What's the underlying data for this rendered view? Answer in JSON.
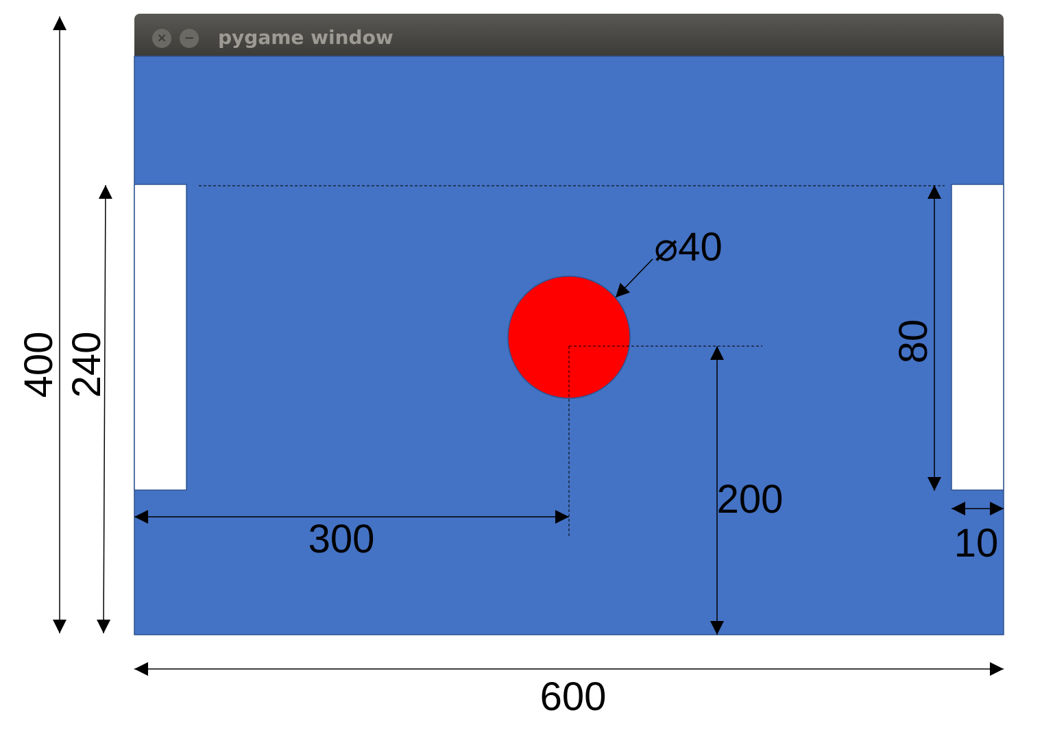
{
  "window": {
    "title": "pygame window"
  },
  "colors": {
    "background": "#4472c4",
    "ball": "#ff0000",
    "paddle": "#ffffff",
    "titlebar": "#3c3b37"
  },
  "icons": {
    "close": "close-icon",
    "minimize": "minimize-icon"
  },
  "dimensions": {
    "window_width": "600",
    "window_height": "400",
    "play_height": "240",
    "paddle_height": "80",
    "paddle_width": "10",
    "ball_diameter": "⌀40",
    "ball_x": "300",
    "ball_y": "200"
  }
}
